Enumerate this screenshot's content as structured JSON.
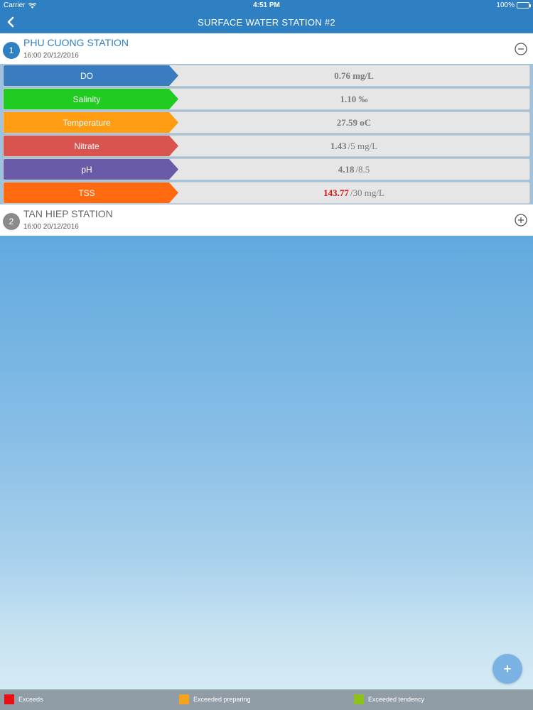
{
  "status_bar": {
    "carrier": "Carrier",
    "time": "4:51 PM",
    "battery": "100%"
  },
  "nav": {
    "title": "SURFACE WATER STATION #2"
  },
  "stations": [
    {
      "number": "1",
      "name": "PHU CUONG STATION",
      "datetime": "16:00 20/12/2016",
      "expanded": true,
      "badge_color": "#2f7fc3",
      "name_color": "#2f7fc3"
    },
    {
      "number": "2",
      "name": "TAN HIEP STATION",
      "datetime": "16:00 20/12/2016",
      "expanded": false,
      "badge_color": "#8b8b8b",
      "name_color": "#666666"
    }
  ],
  "readings": [
    {
      "label": "DO",
      "value": "0.76 mg/L",
      "limit": "",
      "color": "#3a7cc0",
      "value_color": "#7b7b7b"
    },
    {
      "label": "Salinity",
      "value": "1.10 ‰",
      "limit": "",
      "color": "#1fcc1f",
      "value_color": "#7b7b7b"
    },
    {
      "label": "Temperature",
      "value": "27.59 oC",
      "limit": "",
      "color": "#ff9c12",
      "value_color": "#7b7b7b"
    },
    {
      "label": "Nitrate",
      "value": "1.43",
      "limit": "/5 mg/L",
      "color": "#d9534f",
      "value_color": "#7b7b7b"
    },
    {
      "label": "pH",
      "value": "4.18",
      "limit": "/8.5",
      "color": "#6a5aa8",
      "value_color": "#7b7b7b"
    },
    {
      "label": "TSS",
      "value": "143.77",
      "limit": "/30 mg/L",
      "color": "#ff6a10",
      "value_color": "#e01010"
    }
  ],
  "fab": {
    "label": "+"
  },
  "legend": [
    {
      "label": "Exceeds",
      "color": "#e81010"
    },
    {
      "label": "Exceeded preparing",
      "color": "#f7a21b"
    },
    {
      "label": "Exceeded tendency",
      "color": "#8ec21a"
    }
  ]
}
